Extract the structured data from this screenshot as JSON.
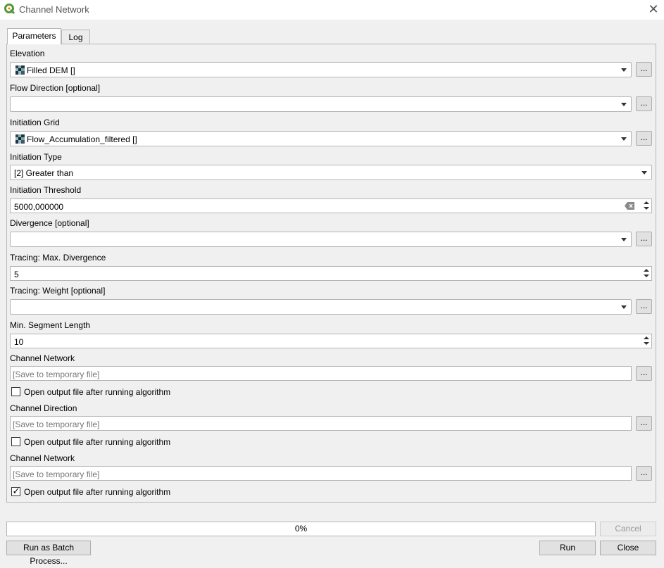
{
  "window": {
    "title": "Channel Network",
    "close_icon": "close-icon",
    "logo_icon": "qgis-logo-icon"
  },
  "tabs": [
    {
      "label": "Parameters",
      "active": true
    },
    {
      "label": "Log",
      "active": false
    }
  ],
  "params": {
    "elevation": {
      "label": "Elevation",
      "value": "Filled DEM []",
      "browse": "..."
    },
    "flow_direction": {
      "label": "Flow Direction [optional]",
      "value": "",
      "browse": "..."
    },
    "initiation_grid": {
      "label": "Initiation Grid",
      "value": "Flow_Accumulation_filtered []",
      "browse": "..."
    },
    "initiation_type": {
      "label": "Initiation Type",
      "value": "[2] Greater than"
    },
    "initiation_threshold": {
      "label": "Initiation Threshold",
      "value": "5000,000000"
    },
    "divergence": {
      "label": "Divergence [optional]",
      "value": "",
      "browse": "..."
    },
    "max_divergence": {
      "label": "Tracing: Max. Divergence",
      "value": "5"
    },
    "tracing_weight": {
      "label": "Tracing: Weight [optional]",
      "value": "",
      "browse": "..."
    },
    "min_segment": {
      "label": "Min. Segment Length",
      "value": "10"
    }
  },
  "outputs": [
    {
      "label": "Channel Network",
      "placeholder": "[Save to temporary file]",
      "browse": "...",
      "open_label": "Open output file after running algorithm",
      "checked": false
    },
    {
      "label": "Channel Direction",
      "placeholder": "[Save to temporary file]",
      "browse": "...",
      "open_label": "Open output file after running algorithm",
      "checked": false
    },
    {
      "label": "Channel Network",
      "placeholder": "[Save to temporary file]",
      "browse": "...",
      "open_label": "Open output file after running algorithm",
      "checked": true
    }
  ],
  "footer": {
    "progress_text": "0%",
    "progress_value": 0,
    "cancel_label": "Cancel",
    "batch_label": "Run as Batch Process...",
    "run_label": "Run",
    "close_label": "Close"
  },
  "colors": {
    "logo_green": "#589632",
    "logo_yellow": "#ee7913"
  }
}
